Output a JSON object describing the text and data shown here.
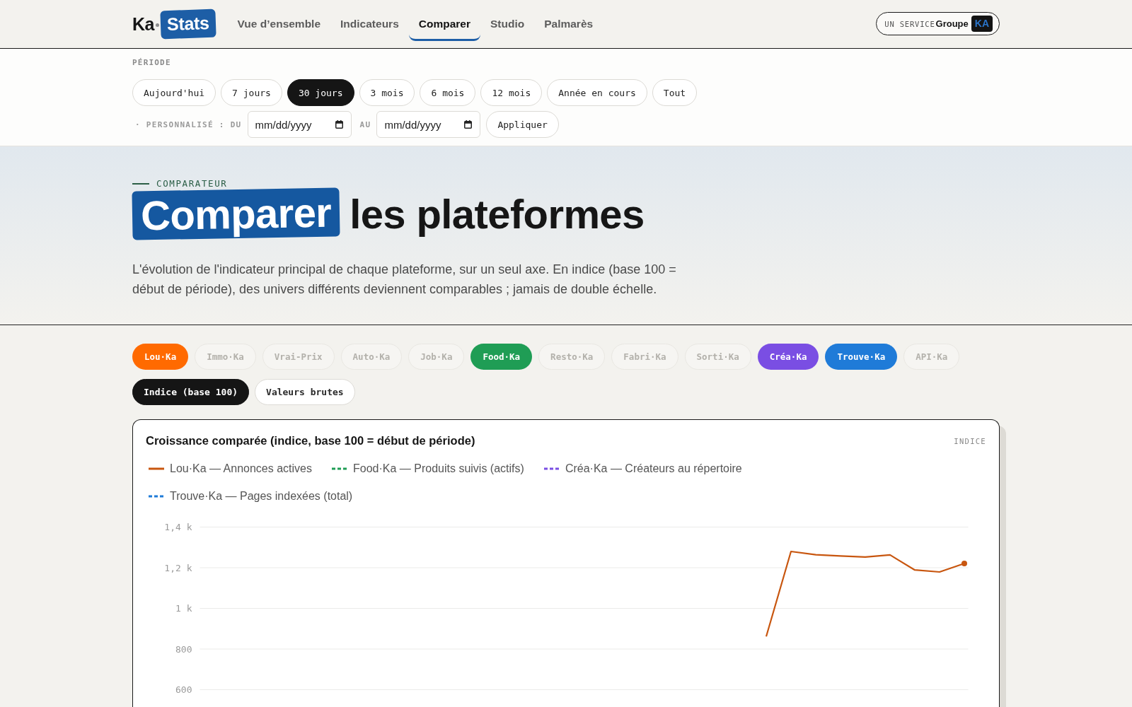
{
  "header": {
    "logo": {
      "prefix": "Ka",
      "word": "Stats"
    },
    "nav": [
      {
        "label": "Vue d’ensemble",
        "selected": false
      },
      {
        "label": "Indicateurs",
        "selected": false
      },
      {
        "label": "Comparer",
        "selected": true
      },
      {
        "label": "Studio",
        "selected": false
      },
      {
        "label": "Palmarès",
        "selected": false
      }
    ],
    "badge": {
      "label": "UN SERVICE",
      "brand": "Groupe",
      "tag": "KA"
    }
  },
  "period": {
    "label": "PÉRIODE",
    "options": [
      {
        "label": "Aujourd'hui",
        "selected": false
      },
      {
        "label": "7 jours",
        "selected": false
      },
      {
        "label": "30 jours",
        "selected": true
      },
      {
        "label": "3 mois",
        "selected": false
      },
      {
        "label": "6 mois",
        "selected": false
      },
      {
        "label": "12 mois",
        "selected": false
      },
      {
        "label": "Année en cours",
        "selected": false
      },
      {
        "label": "Tout",
        "selected": false
      }
    ],
    "custom": {
      "label": "· PERSONNALISÉ : DU",
      "from": {
        "placeholder": "mm/dd/yyyy"
      },
      "separator": "AU",
      "to": {
        "placeholder": "mm/dd/yyyy"
      },
      "apply": "Appliquer"
    }
  },
  "hero": {
    "eyebrow": "COMPARATEUR",
    "title_highlight": "Comparer",
    "title_rest": "les plateformes",
    "intro": "L'évolution de l'indicateur principal de chaque plateforme, sur un seul axe. En indice (base 100 = début de période), des univers différents deviennent comparables ; jamais de double échelle."
  },
  "platforms": [
    {
      "label": "Lou·Ka",
      "selected": true,
      "color": "#ff6a00"
    },
    {
      "label": "Immo·Ka",
      "selected": false
    },
    {
      "label": "Vrai-Prix",
      "selected": false
    },
    {
      "label": "Auto·Ka",
      "selected": false
    },
    {
      "label": "Job·Ka",
      "selected": false
    },
    {
      "label": "Food·Ka",
      "selected": true,
      "color": "#1f9d55"
    },
    {
      "label": "Resto·Ka",
      "selected": false
    },
    {
      "label": "Fabri·Ka",
      "selected": false
    },
    {
      "label": "Sorti·Ka",
      "selected": false
    },
    {
      "label": "Créa·Ka",
      "selected": true,
      "color": "#7a4ee3"
    },
    {
      "label": "Trouve·Ka",
      "selected": true,
      "color": "#1f7bd8"
    },
    {
      "label": "API·Ka",
      "selected": false
    }
  ],
  "modes": [
    {
      "label": "Indice (base 100)",
      "selected": true
    },
    {
      "label": "Valeurs brutes",
      "selected": false
    }
  ],
  "chart": {
    "unit": "INDICE",
    "line_styles": [
      {
        "dashed": false
      },
      {
        "dashed": true
      },
      {
        "dashed": true
      },
      {
        "dashed": true
      }
    ],
    "chart_data": {
      "type": "line",
      "title": "Croissance comparée (indice, base 100 = début de période)",
      "grid": true,
      "ylim": [
        600,
        1400
      ],
      "yticks": [
        600,
        800,
        {
          "value": 1000,
          "label": "1 k"
        },
        {
          "value": 1200,
          "label": "1,2 k"
        },
        {
          "value": 1400,
          "label": "1,4 k"
        }
      ],
      "series": [
        {
          "name": "Lou·Ka — Annonces actives",
          "color": "#c8560f",
          "values": [
            null,
            null,
            null,
            null,
            null,
            null,
            null,
            null,
            null,
            null,
            null,
            null,
            null,
            null,
            null,
            null,
            null,
            null,
            null,
            null,
            null,
            null,
            862,
            1280,
            1264,
            1258,
            1253,
            1263,
            1189,
            1179,
            1221
          ]
        },
        {
          "name": "Food·Ka — Produits suivis (actifs)",
          "color": "#1f9d55",
          "values": [
            null,
            null,
            null,
            null,
            null,
            null,
            null,
            null,
            null,
            null,
            null,
            null,
            null,
            null,
            null,
            null,
            null,
            null,
            null,
            null,
            null,
            null,
            null,
            null,
            null,
            null,
            null,
            null,
            null,
            null,
            null
          ]
        },
        {
          "name": "Créa·Ka — Créateurs au répertoire",
          "color": "#7a4ee3",
          "values": [
            null,
            null,
            null,
            null,
            null,
            null,
            null,
            null,
            null,
            null,
            null,
            null,
            null,
            null,
            null,
            null,
            null,
            null,
            null,
            null,
            null,
            null,
            null,
            null,
            null,
            null,
            null,
            null,
            null,
            null,
            null
          ]
        },
        {
          "name": "Trouve·Ka — Pages indexées (total)",
          "color": "#1f7bd8",
          "values": [
            null,
            null,
            null,
            null,
            null,
            null,
            null,
            null,
            null,
            null,
            null,
            null,
            null,
            null,
            null,
            null,
            null,
            null,
            null,
            null,
            null,
            null,
            null,
            null,
            null,
            null,
            null,
            null,
            null,
            null,
            null
          ]
        }
      ]
    }
  }
}
